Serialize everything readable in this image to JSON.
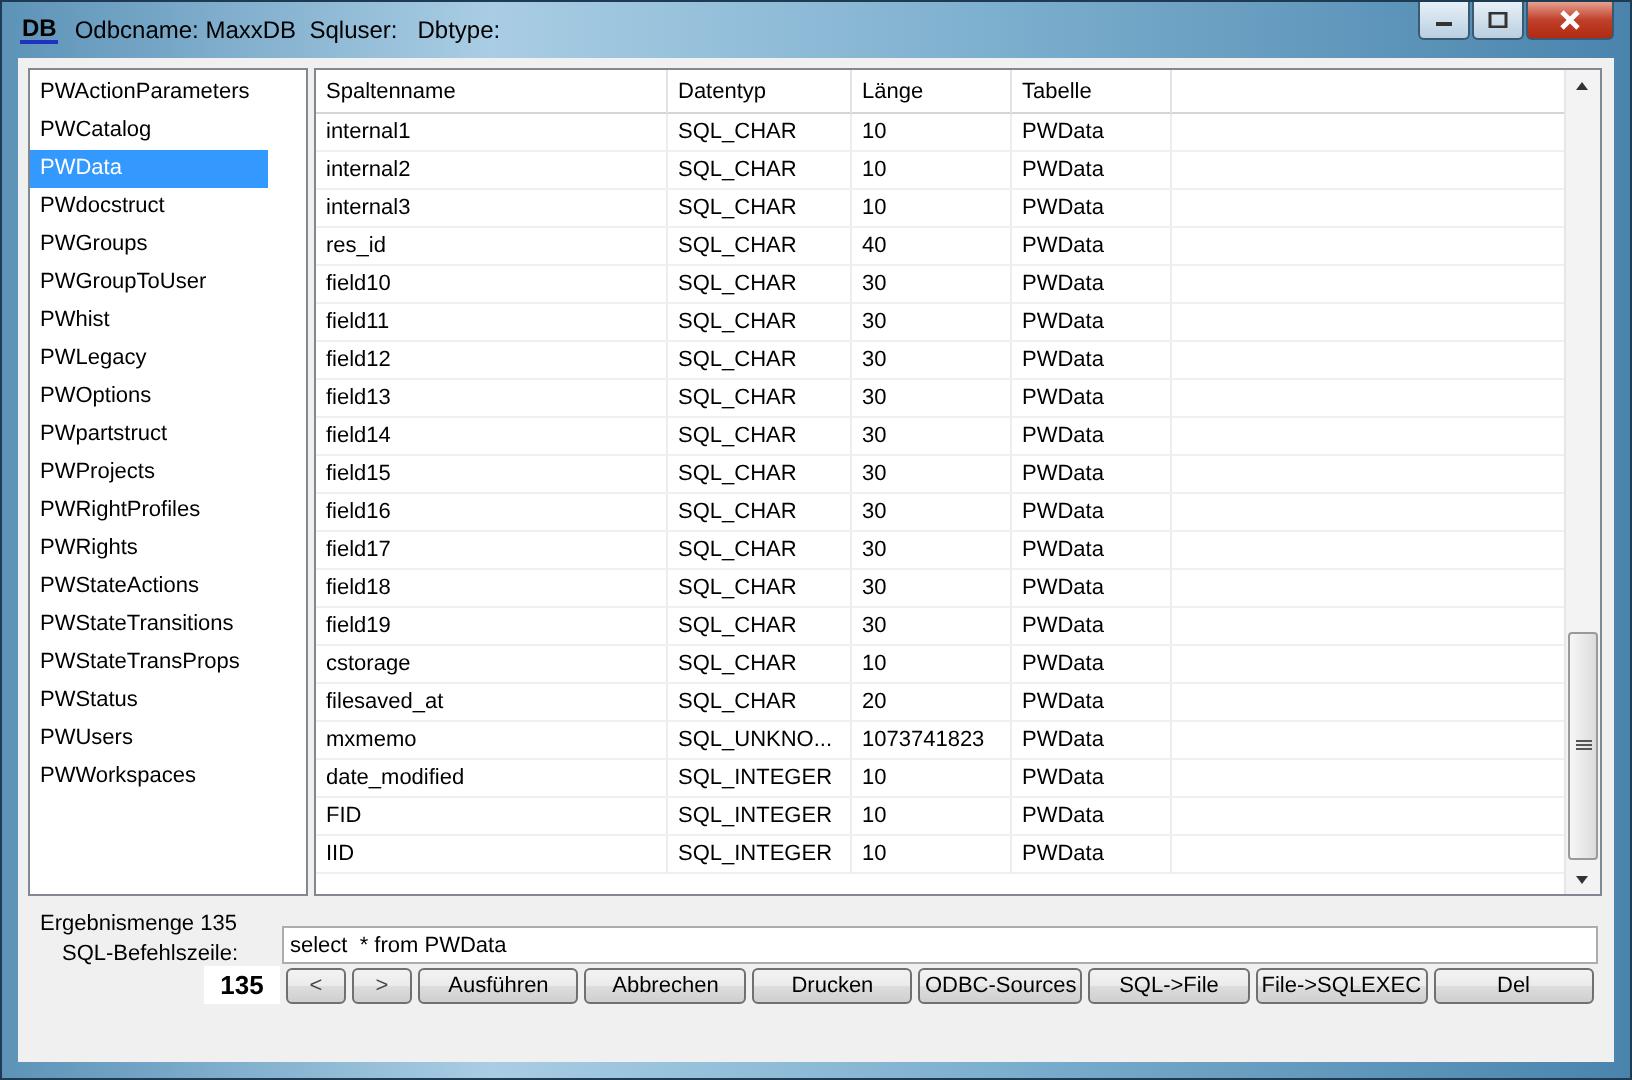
{
  "window": {
    "icon_text": "DB",
    "title": "Odbcname: MaxxDB  Sqluser:   Dbtype:"
  },
  "tables_list": [
    {
      "label": "PWActionParameters",
      "selected": false
    },
    {
      "label": "PWCatalog",
      "selected": false
    },
    {
      "label": "PWData",
      "selected": true
    },
    {
      "label": "PWdocstruct",
      "selected": false
    },
    {
      "label": "PWGroups",
      "selected": false
    },
    {
      "label": "PWGroupToUser",
      "selected": false
    },
    {
      "label": "PWhist",
      "selected": false
    },
    {
      "label": "PWLegacy",
      "selected": false
    },
    {
      "label": "PWOptions",
      "selected": false
    },
    {
      "label": "PWpartstruct",
      "selected": false
    },
    {
      "label": "PWProjects",
      "selected": false
    },
    {
      "label": "PWRightProfiles",
      "selected": false
    },
    {
      "label": "PWRights",
      "selected": false
    },
    {
      "label": "PWStateActions",
      "selected": false
    },
    {
      "label": "PWStateTransitions",
      "selected": false
    },
    {
      "label": "PWStateTransProps",
      "selected": false
    },
    {
      "label": "PWStatus",
      "selected": false
    },
    {
      "label": "PWUsers",
      "selected": false
    },
    {
      "label": "PWWorkspaces",
      "selected": false
    }
  ],
  "table": {
    "columns": [
      "Spaltenname",
      "Datentyp",
      "Länge",
      "Tabelle"
    ],
    "rows": [
      [
        "internal1",
        "SQL_CHAR",
        "10",
        "PWData"
      ],
      [
        "internal2",
        "SQL_CHAR",
        "10",
        "PWData"
      ],
      [
        "internal3",
        "SQL_CHAR",
        "10",
        "PWData"
      ],
      [
        "res_id",
        "SQL_CHAR",
        "40",
        "PWData"
      ],
      [
        "field10",
        "SQL_CHAR",
        "30",
        "PWData"
      ],
      [
        "field11",
        "SQL_CHAR",
        "30",
        "PWData"
      ],
      [
        "field12",
        "SQL_CHAR",
        "30",
        "PWData"
      ],
      [
        "field13",
        "SQL_CHAR",
        "30",
        "PWData"
      ],
      [
        "field14",
        "SQL_CHAR",
        "30",
        "PWData"
      ],
      [
        "field15",
        "SQL_CHAR",
        "30",
        "PWData"
      ],
      [
        "field16",
        "SQL_CHAR",
        "30",
        "PWData"
      ],
      [
        "field17",
        "SQL_CHAR",
        "30",
        "PWData"
      ],
      [
        "field18",
        "SQL_CHAR",
        "30",
        "PWData"
      ],
      [
        "field19",
        "SQL_CHAR",
        "30",
        "PWData"
      ],
      [
        "cstorage",
        "SQL_CHAR",
        "10",
        "PWData"
      ],
      [
        "filesaved_at",
        "SQL_CHAR",
        "20",
        "PWData"
      ],
      [
        "mxmemo",
        "SQL_UNKNO...",
        "1073741823",
        "PWData"
      ],
      [
        "date_modified",
        "SQL_INTEGER",
        "10",
        "PWData"
      ],
      [
        "FID",
        "SQL_INTEGER",
        "10",
        "PWData"
      ],
      [
        "IID",
        "SQL_INTEGER",
        "10",
        "PWData"
      ]
    ]
  },
  "result_count_label": "Ergebnismenge 135",
  "sql_label": "SQL-Befehlszeile:",
  "sql_input": {
    "value": "select  * from PWData"
  },
  "count_display": "135",
  "buttons": [
    {
      "label": "<",
      "kind": "nav"
    },
    {
      "label": ">",
      "kind": "nav"
    },
    {
      "label": "Ausführen",
      "kind": "action"
    },
    {
      "label": "Abbrechen",
      "kind": "action"
    },
    {
      "label": "Drucken",
      "kind": "action"
    },
    {
      "label": "ODBC-Sources",
      "kind": "action"
    },
    {
      "label": "SQL->File",
      "kind": "action"
    },
    {
      "label": "File->SQLEXEC",
      "kind": "action"
    },
    {
      "label": "Del",
      "kind": "action"
    }
  ]
}
